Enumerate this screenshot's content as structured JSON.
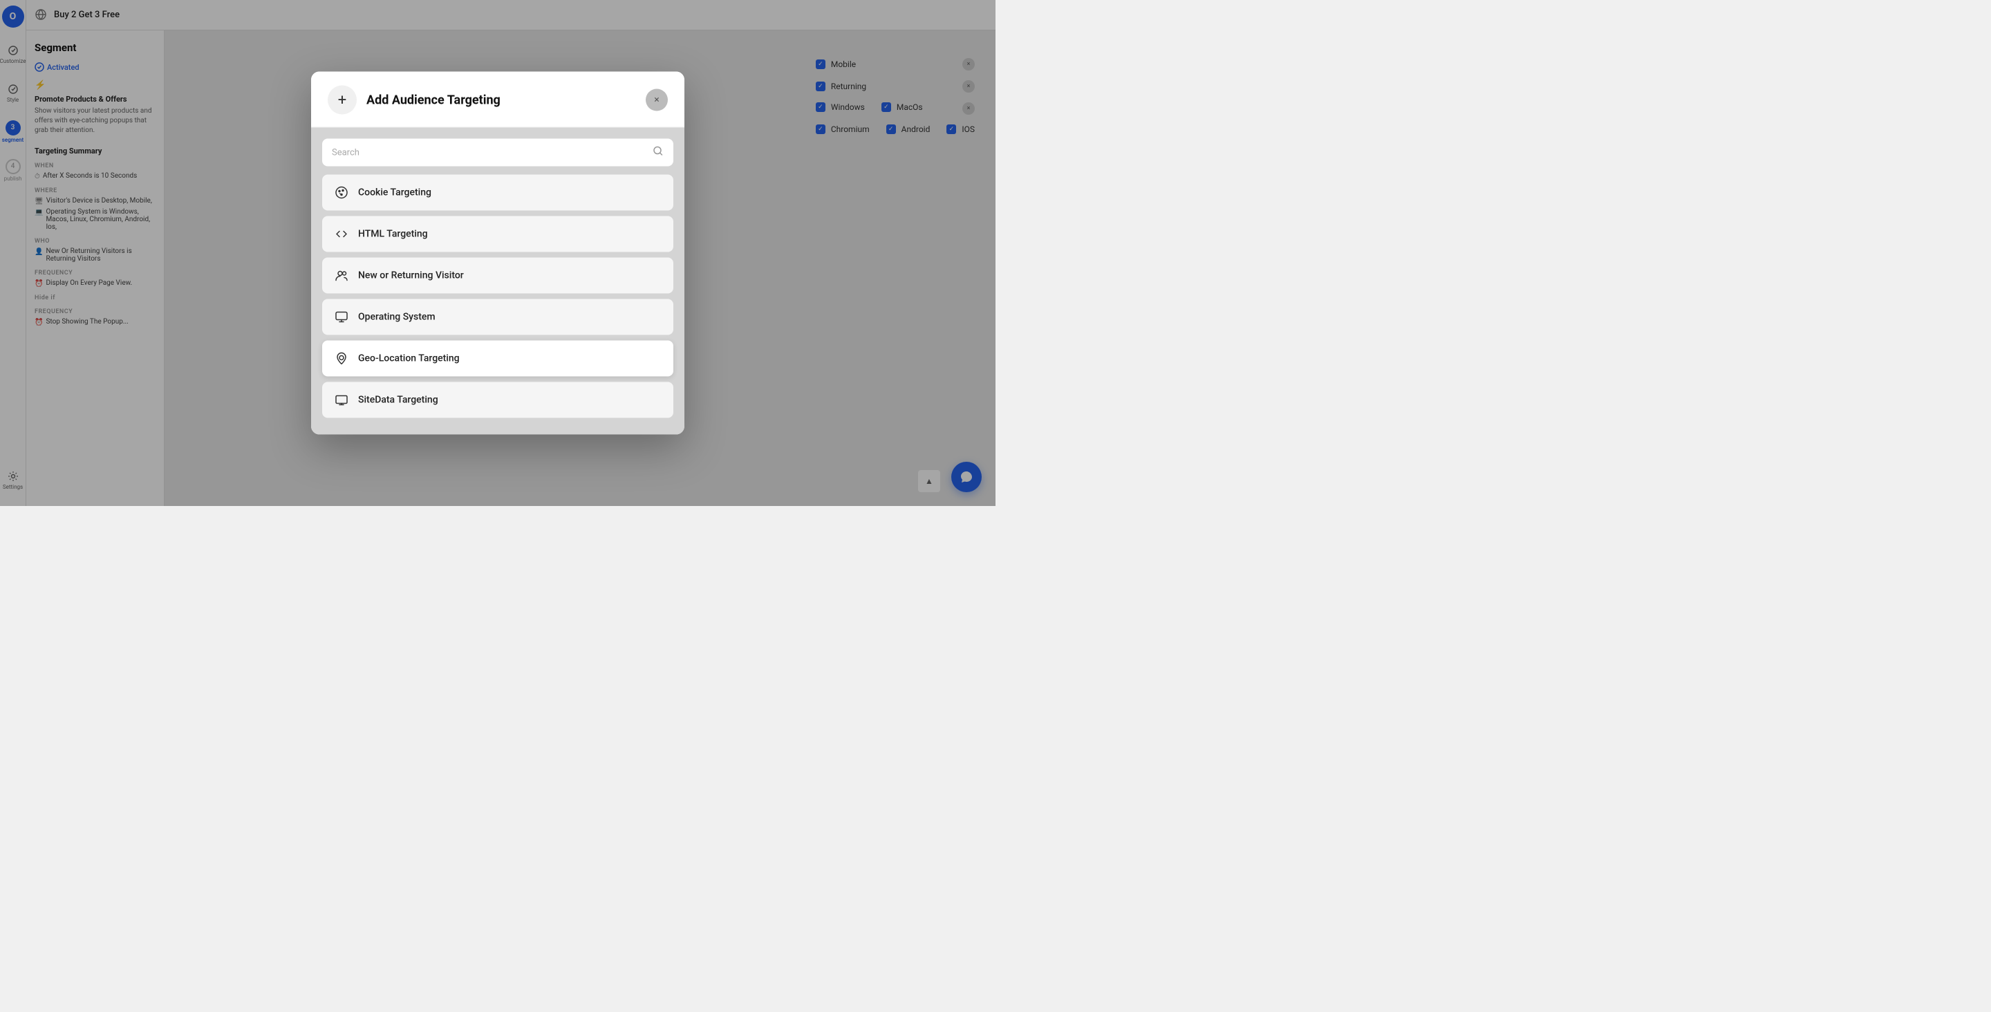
{
  "app": {
    "logo_label": "O",
    "campaign_title": "Buy 2 Get 3 Free"
  },
  "left_nav": {
    "items": [
      {
        "id": "customize",
        "label": "Customize",
        "step": null,
        "icon": "✓",
        "active": false
      },
      {
        "id": "style",
        "label": "Style",
        "step": null,
        "icon": "✓",
        "active": false
      },
      {
        "id": "segment",
        "label": "Segment",
        "step": "3",
        "active": true
      },
      {
        "id": "publish",
        "label": "Publish",
        "step": "4",
        "icon": null,
        "active": false
      },
      {
        "id": "settings",
        "label": "Settings",
        "icon": "⚙",
        "active": false
      }
    ]
  },
  "segment_panel": {
    "title": "Segment",
    "activated_label": "Activated",
    "lightning_icon": "⚡",
    "promo_title": "Promote Products & Offers",
    "promo_desc": "Show visitors your latest products and offers with eye-catching popups that grab their attention.",
    "targeting_summary_title": "Targeting Summary",
    "sections": [
      {
        "label": "WHEN",
        "items": [
          "After X Seconds is 10 Seconds"
        ]
      },
      {
        "label": "WHERE",
        "items": [
          "Visitor's Device is Desktop, Mobile,",
          "Operating System is Windows, Macos, Linux, Chromium, Android, Ios,"
        ]
      },
      {
        "label": "WHO",
        "items": [
          "New Or Returning Visitors is Returning Visitors"
        ]
      },
      {
        "label": "FREQUENCY",
        "items": [
          "Display On Every Page View."
        ]
      },
      {
        "label": "Hide if",
        "items": []
      },
      {
        "label": "FREQUENCY",
        "items": [
          "Stop Showing The Popup..."
        ]
      }
    ]
  },
  "right_panel": {
    "checkboxes": [
      {
        "label": "Mobile",
        "checked": true
      },
      {
        "label": "Returning",
        "checked": true
      },
      {
        "label": "Windows",
        "checked": true
      },
      {
        "label": "MacOs",
        "checked": true
      },
      {
        "label": "Chromium",
        "checked": true
      },
      {
        "label": "Android",
        "checked": true
      },
      {
        "label": "IOS",
        "checked": true
      }
    ]
  },
  "modal": {
    "plus_icon": "+",
    "title": "Add Audience Targeting",
    "close_icon": "×",
    "search": {
      "placeholder": "Search",
      "icon": "🔍"
    },
    "items": [
      {
        "id": "cookie-targeting",
        "label": "Cookie Targeting",
        "icon_type": "cookie"
      },
      {
        "id": "html-targeting",
        "label": "HTML Targeting",
        "icon_type": "code"
      },
      {
        "id": "new-or-returning",
        "label": "New or Returning Visitor",
        "icon_type": "users"
      },
      {
        "id": "operating-system",
        "label": "Operating System",
        "icon_type": "monitor"
      },
      {
        "id": "geo-location",
        "label": "Geo-Location Targeting",
        "icon_type": "location",
        "highlighted": true
      },
      {
        "id": "sitedata",
        "label": "SiteData Targeting",
        "icon_type": "display"
      }
    ]
  },
  "chat_btn": "💬",
  "scroll_up_icon": "▲"
}
